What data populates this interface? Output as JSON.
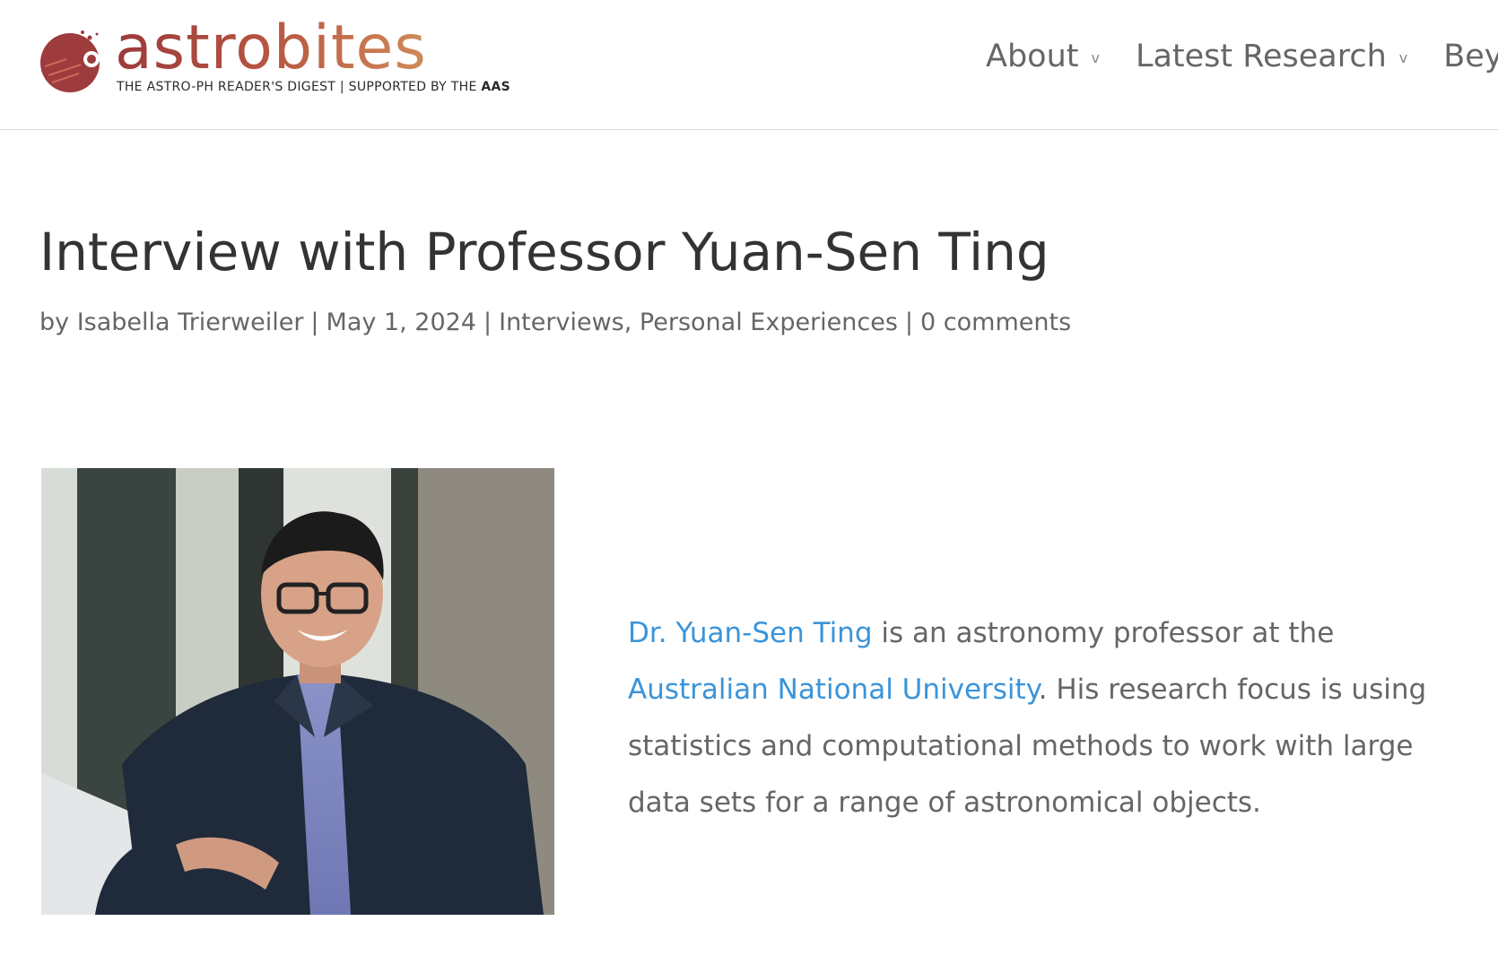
{
  "header": {
    "logo": {
      "wordmark": "astrobites",
      "tagline_prefix": "THE ASTRO-PH READER'S DIGEST  |  SUPPORTED BY THE ",
      "tagline_brand": "AAS",
      "colors": {
        "dark": "#9c3a3c",
        "light": "#d08a58"
      }
    },
    "nav": [
      {
        "label": "About",
        "chevron": "v"
      },
      {
        "label": "Latest Research",
        "chevron": "v"
      },
      {
        "label": "Bey"
      }
    ]
  },
  "post": {
    "title": "Interview with Professor Yuan-Sen Ting",
    "meta": {
      "by": "by",
      "author": "Isabella Trierweiler",
      "sep": "|",
      "date": "May 1, 2024",
      "category_1": "Interviews",
      "category_2": "Personal Experiences",
      "comma": ",",
      "comments": "0 comments"
    },
    "image": {
      "alt": "Photo of Yuan-Sen Ting"
    },
    "intro": {
      "link_name": "Dr. Yuan-Sen Ting",
      "text_1": " is an astronomy professor at the ",
      "link_university": "Australian National University",
      "text_2": ". His research focus is using statistics and computational methods to work with large data sets for a range of astronomical objects."
    }
  },
  "colors": {
    "link": "#3b94d9",
    "title": "#333333",
    "body": "#666666",
    "border": "#d9d9d9"
  }
}
